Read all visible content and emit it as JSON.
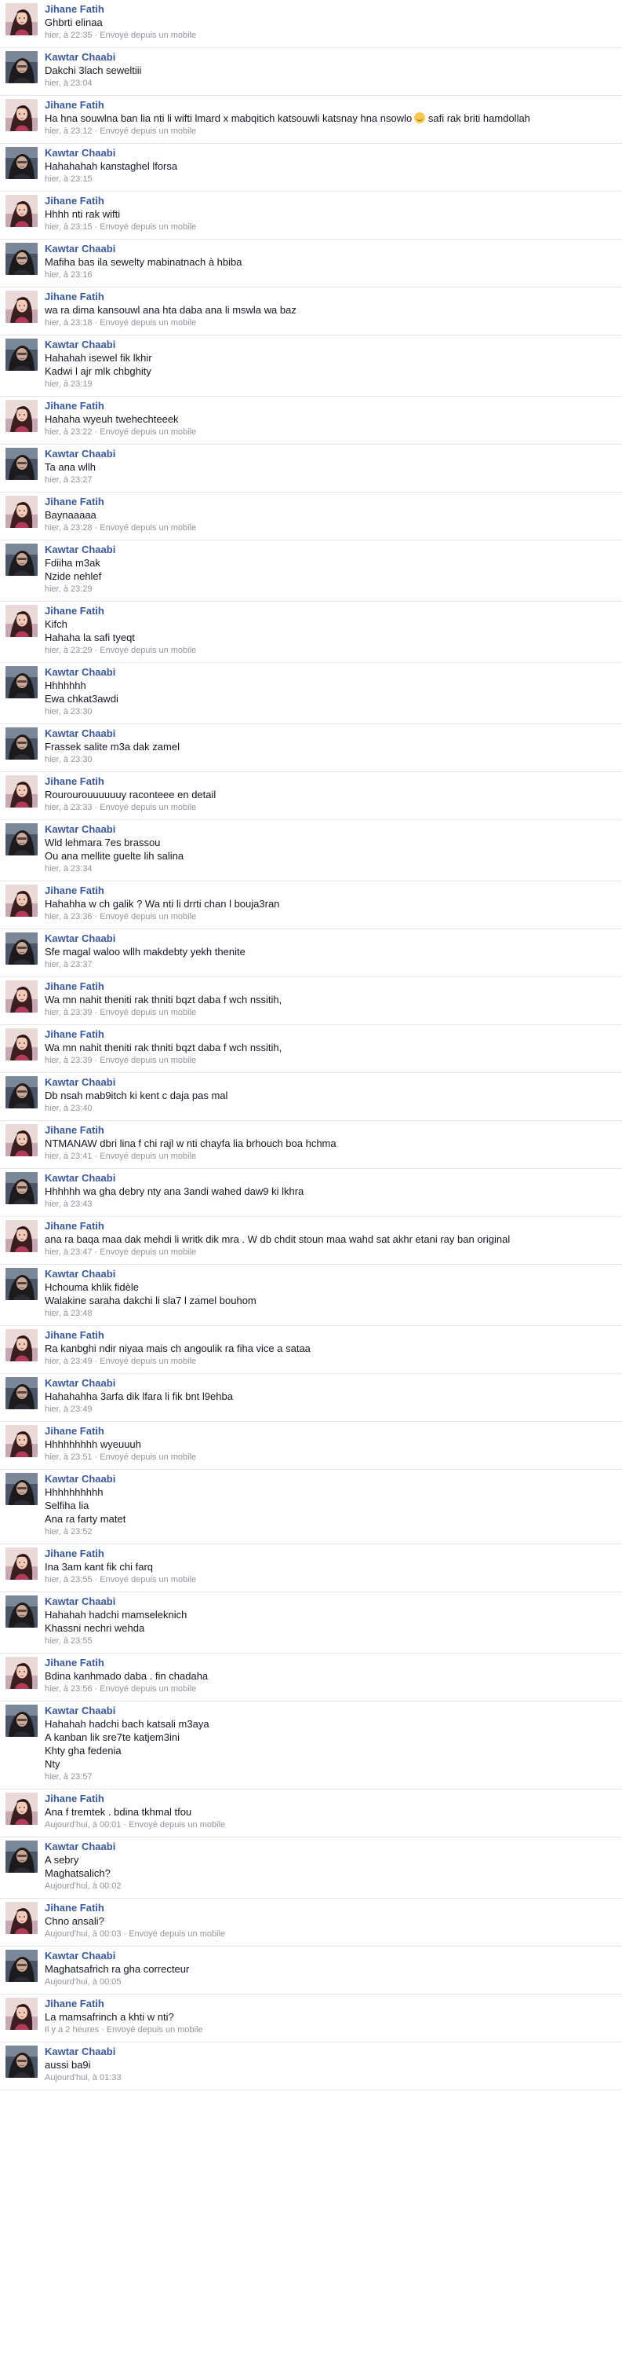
{
  "messages": [
    {
      "sender": "Jihane Fatih",
      "lines": [
        "Ghbrti elinaa"
      ],
      "time": "hier, à 22:35",
      "source": "Envoyé depuis un mobile"
    },
    {
      "sender": "Kawtar Chaabi",
      "lines": [
        "Dakchi 3lach seweltiii"
      ],
      "time": "hier, à 23:04",
      "source": ""
    },
    {
      "sender": "Jihane Fatih",
      "lines": [
        "Ha hna souwlna ban lia nti li wifti lmard x mabqitich katsouwli katsnay hna nsowlo",
        "safi rak briti hamdollah"
      ],
      "emoji_after_first": true,
      "time": "hier, à 23:12",
      "source": "Envoyé depuis un mobile"
    },
    {
      "sender": "Kawtar Chaabi",
      "lines": [
        "Hahahahah kanstaghel lforsa"
      ],
      "time": "hier, à 23:15",
      "source": ""
    },
    {
      "sender": "Jihane Fatih",
      "lines": [
        "Hhhh nti rak wifti"
      ],
      "time": "hier, à 23:15",
      "source": "Envoyé depuis un mobile"
    },
    {
      "sender": "Kawtar Chaabi",
      "lines": [
        "Mafiha bas ila sewelty mabinatnach à hbiba"
      ],
      "time": "hier, à 23:16",
      "source": ""
    },
    {
      "sender": "Jihane Fatih",
      "lines": [
        "wa ra dima kansouwl ana hta daba ana li mswla wa baz"
      ],
      "time": "hier, à 23:18",
      "source": "Envoyé depuis un mobile"
    },
    {
      "sender": "Kawtar Chaabi",
      "lines": [
        "Hahahah isewel fik lkhir",
        "Kadwi l ajr mlk chbghity"
      ],
      "time": "hier, à 23:19",
      "source": ""
    },
    {
      "sender": "Jihane Fatih",
      "lines": [
        "Hahaha wyeuh twehechteeek"
      ],
      "time": "hier, à 23:22",
      "source": "Envoyé depuis un mobile"
    },
    {
      "sender": "Kawtar Chaabi",
      "lines": [
        "Ta ana wllh"
      ],
      "time": "hier, à 23:27",
      "source": ""
    },
    {
      "sender": "Jihane Fatih",
      "lines": [
        "Baynaaaaa"
      ],
      "time": "hier, à 23:28",
      "source": "Envoyé depuis un mobile"
    },
    {
      "sender": "Kawtar Chaabi",
      "lines": [
        "Fdiiha m3ak",
        "Nzide nehlef"
      ],
      "time": "hier, à 23:29",
      "source": ""
    },
    {
      "sender": "Jihane Fatih",
      "lines": [
        "Kifch",
        "Hahaha la safi tyeqt"
      ],
      "time": "hier, à 23:29",
      "source": "Envoyé depuis un mobile"
    },
    {
      "sender": "Kawtar Chaabi",
      "lines": [
        "Hhhhhhh",
        "Ewa chkat3awdi"
      ],
      "time": "hier, à 23:30",
      "source": ""
    },
    {
      "sender": "Kawtar Chaabi",
      "lines": [
        "Frassek salite m3a dak zamel"
      ],
      "time": "hier, à 23:30",
      "source": ""
    },
    {
      "sender": "Jihane Fatih",
      "lines": [
        "Rourourouuuuuuy raconteee en detail"
      ],
      "time": "hier, à 23:33",
      "source": "Envoyé depuis un mobile"
    },
    {
      "sender": "Kawtar Chaabi",
      "lines": [
        "Wld lehmara 7es brassou",
        "Ou ana mellite guelte lih salina"
      ],
      "time": "hier, à 23:34",
      "source": ""
    },
    {
      "sender": "Jihane Fatih",
      "lines": [
        "Hahahha w ch galik ? Wa nti li drrti chan l bouja3ran"
      ],
      "time": "hier, à 23:36",
      "source": "Envoyé depuis un mobile"
    },
    {
      "sender": "Kawtar Chaabi",
      "lines": [
        "Sfe magal waloo wllh makdebty yekh thenite"
      ],
      "time": "hier, à 23:37",
      "source": ""
    },
    {
      "sender": "Jihane Fatih",
      "lines": [
        "Wa mn nahit theniti rak thniti bqzt daba f wch nssitih,"
      ],
      "time": "hier, à 23:39",
      "source": "Envoyé depuis un mobile"
    },
    {
      "sender": "Jihane Fatih",
      "lines": [
        "Wa mn nahit theniti rak thniti bqzt daba f wch nssitih,"
      ],
      "time": "hier, à 23:39",
      "source": "Envoyé depuis un mobile"
    },
    {
      "sender": "Kawtar Chaabi",
      "lines": [
        "Db nsah mab9itch ki kent c daja pas mal"
      ],
      "time": "hier, à 23:40",
      "source": ""
    },
    {
      "sender": "Jihane Fatih",
      "lines": [
        "NTMANAW dbri lina f chi rajl w nti chayfa lia brhouch boa hchma"
      ],
      "time": "hier, à 23:41",
      "source": "Envoyé depuis un mobile"
    },
    {
      "sender": "Kawtar Chaabi",
      "lines": [
        "Hhhhhh wa gha debry nty ana 3andi wahed daw9 ki lkhra"
      ],
      "time": "hier, à 23:43",
      "source": ""
    },
    {
      "sender": "Jihane Fatih",
      "lines": [
        "ana ra baqa maa dak mehdi li writk dik mra . W db chdit stoun maa wahd sat akhr etani ray ban original"
      ],
      "time": "hier, à 23:47",
      "source": "Envoyé depuis un mobile"
    },
    {
      "sender": "Kawtar Chaabi",
      "lines": [
        "Hchouma khlik fidèle",
        "Walakine saraha dakchi li sla7 l zamel bouhom"
      ],
      "time": "hier, à 23:48",
      "source": ""
    },
    {
      "sender": "Jihane Fatih",
      "lines": [
        "Ra kanbghi ndir niyaa mais ch angoulik ra fiha vice a sataa"
      ],
      "time": "hier, à 23:49",
      "source": "Envoyé depuis un mobile"
    },
    {
      "sender": "Kawtar Chaabi",
      "lines": [
        "Hahahahha 3arfa dik lfara li fik bnt l9ehba"
      ],
      "time": "hier, à 23:49",
      "source": ""
    },
    {
      "sender": "Jihane Fatih",
      "lines": [
        "Hhhhhhhhh wyeuuuh"
      ],
      "time": "hier, à 23:51",
      "source": "Envoyé depuis un mobile"
    },
    {
      "sender": "Kawtar Chaabi",
      "lines": [
        "Hhhhhhhhhh",
        "Selfiha lia",
        "Ana ra farty matet"
      ],
      "time": "hier, à 23:52",
      "source": ""
    },
    {
      "sender": "Jihane Fatih",
      "lines": [
        "Ina 3am kant fik chi farq"
      ],
      "time": "hier, à 23:55",
      "source": "Envoyé depuis un mobile"
    },
    {
      "sender": "Kawtar Chaabi",
      "lines": [
        "Hahahah hadchi mamseleknich",
        "Khassni nechri wehda"
      ],
      "time": "hier, à 23:55",
      "source": ""
    },
    {
      "sender": "Jihane Fatih",
      "lines": [
        "Bdina kanhmado daba . fin chadaha"
      ],
      "time": "hier, à 23:56",
      "source": "Envoyé depuis un mobile"
    },
    {
      "sender": "Kawtar Chaabi",
      "lines": [
        "Hahahah hadchi bach katsali m3aya",
        "A kanban lik sre7te katjem3ini",
        "Khty gha fedenia",
        "Nty"
      ],
      "time": "hier, à 23:57",
      "source": ""
    },
    {
      "sender": "Jihane Fatih",
      "lines": [
        "Ana f tremtek . bdina tkhmal tfou"
      ],
      "time": "Aujourd'hui, à 00:01",
      "source": "Envoyé depuis un mobile"
    },
    {
      "sender": "Kawtar Chaabi",
      "lines": [
        "A sebry",
        "Maghatsalich?"
      ],
      "time": "Aujourd'hui, à 00:02",
      "source": ""
    },
    {
      "sender": "Jihane Fatih",
      "lines": [
        "Chno ansali?"
      ],
      "time": "Aujourd'hui, à 00:03",
      "source": "Envoyé depuis un mobile"
    },
    {
      "sender": "Kawtar Chaabi",
      "lines": [
        "Maghatsafrich ra gha correcteur"
      ],
      "time": "Aujourd'hui, à 00:05",
      "source": ""
    },
    {
      "sender": "Jihane Fatih",
      "lines": [
        "La mamsafrinch a khti w nti?"
      ],
      "time": "Il y a 2 heures",
      "source": "Envoyé depuis un mobile"
    },
    {
      "sender": "Kawtar Chaabi",
      "lines": [
        "aussi ba9i"
      ],
      "time": "Aujourd'hui, à 01:33",
      "source": ""
    }
  ],
  "separator": "·",
  "colors": {
    "author": "#3b5998",
    "text": "#141823",
    "meta": "#90949c",
    "divider": "#e5e5e5"
  },
  "avatars": {
    "Jihane Fatih": "avatar-jihane",
    "Kawtar Chaabi": "avatar-kawtar"
  }
}
